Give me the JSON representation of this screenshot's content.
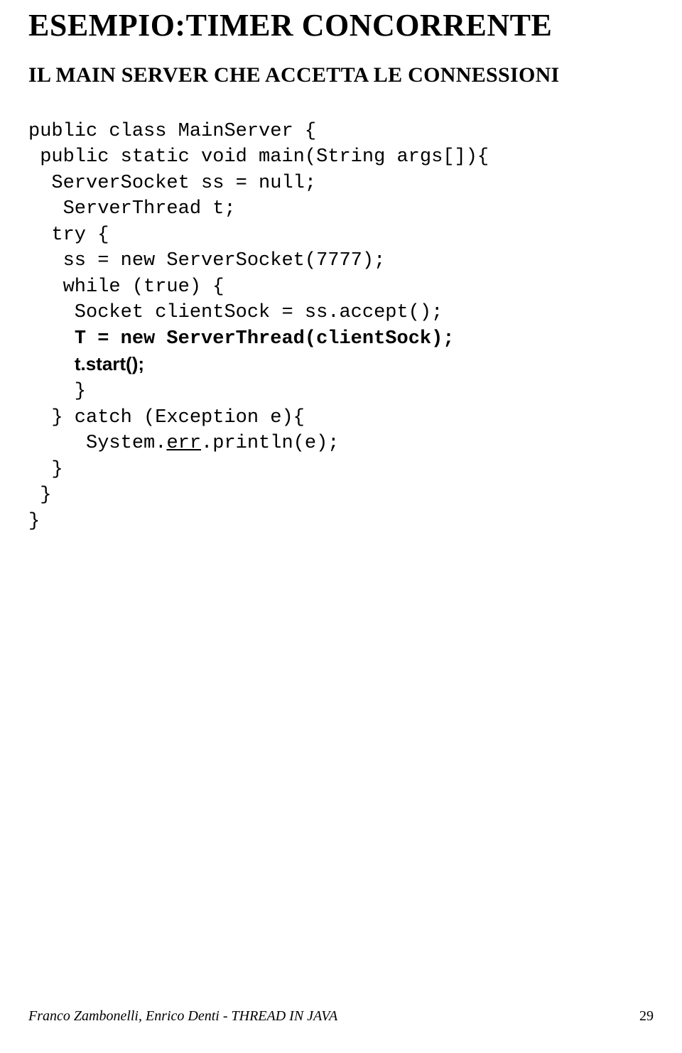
{
  "heading": "ESEMPIO:TIMER CONCORRENTE",
  "subheading": "IL MAIN SERVER CHE ACCETTA LE CONNESSIONI",
  "code": {
    "l1": "public class MainServer {",
    "l2": " public static void main(String args[]){",
    "l3": "  ServerSocket ss = null;",
    "l4": "   ServerThread t;",
    "l5": "  try {",
    "l6": "   ss = new ServerSocket(7777);",
    "l7": "   while (true) {",
    "l8": "    Socket clientSock = ss.accept();",
    "l9a": "    ",
    "l9b": "T = new ServerThread(clientSock);",
    "l10a": "    ",
    "l10b": "t.start();",
    "l11": "    }",
    "l12": "  } catch (Exception e){",
    "l13a": "     System.",
    "l13b": "err",
    "l13c": ".println(e);",
    "l14": "  }",
    "l15": " }",
    "l16": "}"
  },
  "footer": {
    "left": "Franco Zambonelli, Enrico Denti - THREAD IN JAVA",
    "page": "29"
  }
}
